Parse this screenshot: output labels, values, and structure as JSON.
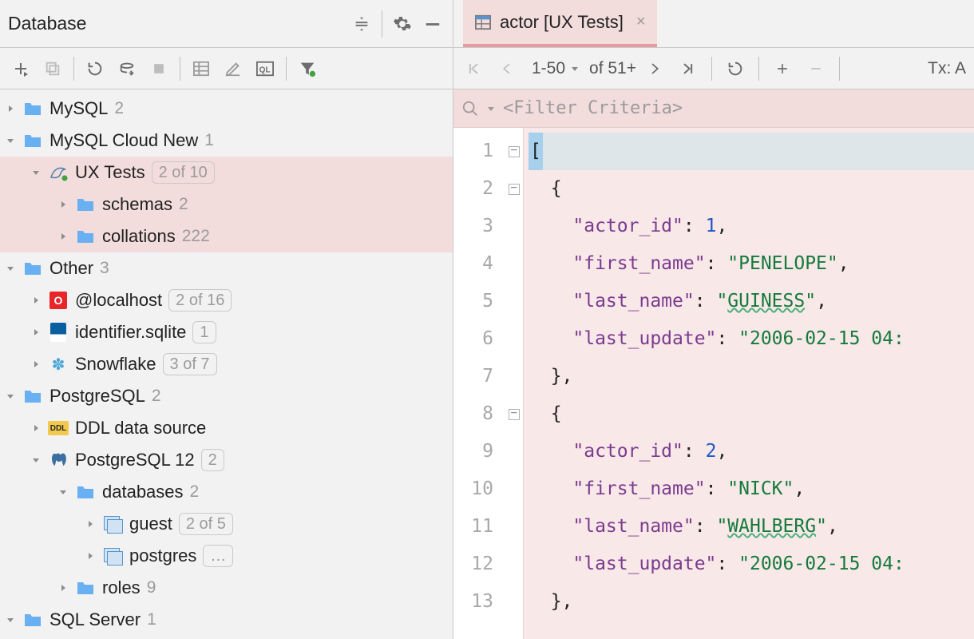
{
  "panel": {
    "title": "Database"
  },
  "tree": {
    "mysql": {
      "label": "MySQL",
      "count": "2"
    },
    "mysql_cloud": {
      "label": "MySQL Cloud New",
      "count": "1"
    },
    "ux_tests": {
      "label": "UX Tests",
      "pill": "2 of 10"
    },
    "schemas": {
      "label": "schemas",
      "count": "2"
    },
    "collations": {
      "label": "collations",
      "count": "222"
    },
    "other": {
      "label": "Other",
      "count": "3"
    },
    "localhost": {
      "label": "@localhost",
      "pill": "2 of 16"
    },
    "identifier": {
      "label": "identifier.sqlite",
      "pill": "1"
    },
    "snowflake": {
      "label": "Snowflake",
      "pill": "3 of 7"
    },
    "postgresql": {
      "label": "PostgreSQL",
      "count": "2"
    },
    "ddl": {
      "label": "DDL data source"
    },
    "pg12": {
      "label": "PostgreSQL 12",
      "pill": "2"
    },
    "databases": {
      "label": "databases",
      "count": "2"
    },
    "guest": {
      "label": "guest",
      "pill": "2 of 5"
    },
    "postgres_db": {
      "label": "postgres",
      "pill": "…"
    },
    "roles": {
      "label": "roles",
      "count": "9"
    },
    "sqlserver": {
      "label": "SQL Server",
      "count": "1"
    }
  },
  "tab": {
    "label": "actor [UX Tests]"
  },
  "editor_toolbar": {
    "range": "1-50",
    "of": "of 51+",
    "tx": "Tx: A"
  },
  "filter": {
    "placeholder": "<Filter Criteria>"
  },
  "code": {
    "l1": "[",
    "l2_indent": "  ",
    "l2": "{",
    "kv_indent": "    ",
    "k_actor_id": "\"actor_id\"",
    "k_first": "\"first_name\"",
    "k_last": "\"last_name\"",
    "k_update": "\"last_update\"",
    "v_id1": "1",
    "v_first1": "\"PENELOPE\"",
    "v_last1_q": "\"",
    "v_last1": "GUINESS",
    "v_update1": "\"2006-02-15 04:",
    "close_brace": "},",
    "open_brace": "{",
    "v_id2": "2",
    "v_first2": "\"NICK\"",
    "v_last2": "WAHLBERG",
    "v_update2": "\"2006-02-15 04:",
    "line13": "},",
    "colon": ":",
    "comma": ","
  }
}
